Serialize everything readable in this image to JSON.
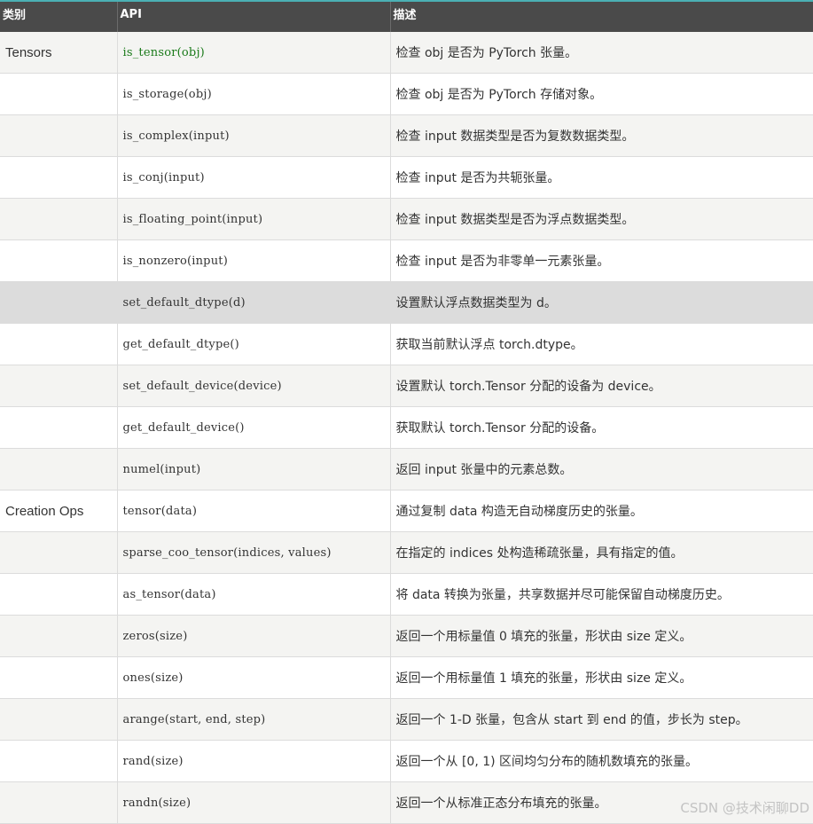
{
  "header": {
    "col_category": "类别",
    "col_api": "API",
    "col_desc": "描述"
  },
  "rows": [
    {
      "category": "Tensors",
      "api": "is_tensor(obj)",
      "desc": "检查 obj 是否为 PyTorch 张量。"
    },
    {
      "category": "",
      "api": "is_storage(obj)",
      "desc": "检查 obj 是否为 PyTorch 存储对象。"
    },
    {
      "category": "",
      "api": "is_complex(input)",
      "desc": "检查 input 数据类型是否为复数数据类型。"
    },
    {
      "category": "",
      "api": "is_conj(input)",
      "desc": "检查 input 是否为共轭张量。"
    },
    {
      "category": "",
      "api": "is_floating_point(input)",
      "desc": "检查 input 数据类型是否为浮点数据类型。"
    },
    {
      "category": "",
      "api": "is_nonzero(input)",
      "desc": "检查 input 是否为非零单一元素张量。"
    },
    {
      "category": "",
      "api": "set_default_dtype(d)",
      "desc": "设置默认浮点数据类型为 d。"
    },
    {
      "category": "",
      "api": "get_default_dtype()",
      "desc": "获取当前默认浮点 torch.dtype。"
    },
    {
      "category": "",
      "api": "set_default_device(device)",
      "desc": "设置默认 torch.Tensor 分配的设备为 device。"
    },
    {
      "category": "",
      "api": "get_default_device()",
      "desc": "获取默认 torch.Tensor 分配的设备。"
    },
    {
      "category": "",
      "api": "numel(input)",
      "desc": "返回 input 张量中的元素总数。"
    },
    {
      "category": "Creation Ops",
      "api": "tensor(data)",
      "desc": "通过复制 data 构造无自动梯度历史的张量。"
    },
    {
      "category": "",
      "api": "sparse_coo_tensor(indices, values)",
      "desc": "在指定的 indices 处构造稀疏张量，具有指定的值。"
    },
    {
      "category": "",
      "api": "as_tensor(data)",
      "desc": "将 data 转换为张量，共享数据并尽可能保留自动梯度历史。"
    },
    {
      "category": "",
      "api": "zeros(size)",
      "desc": "返回一个用标量值 0 填充的张量，形状由 size 定义。"
    },
    {
      "category": "",
      "api": "ones(size)",
      "desc": "返回一个用标量值 1 填充的张量，形状由 size 定义。"
    },
    {
      "category": "",
      "api": "arange(start, end, step)",
      "desc": "返回一个 1-D 张量，包含从 start 到 end 的值，步长为 step。"
    },
    {
      "category": "",
      "api": "rand(size)",
      "desc": "返回一个从 [0, 1) 区间均匀分布的随机数填充的张量。"
    },
    {
      "category": "",
      "api": "randn(size)",
      "desc": "返回一个从标准正态分布填充的张量。"
    }
  ],
  "watermark": "CSDN @技术闲聊DD",
  "colors": {
    "header_bg": "#4a4a4a",
    "header_accent": "#4bb0b4",
    "row_odd": "#f4f4f2",
    "row_even": "#ffffff",
    "row_highlight": "#dcdcdc",
    "api_link_green": "#1a7a1a"
  }
}
